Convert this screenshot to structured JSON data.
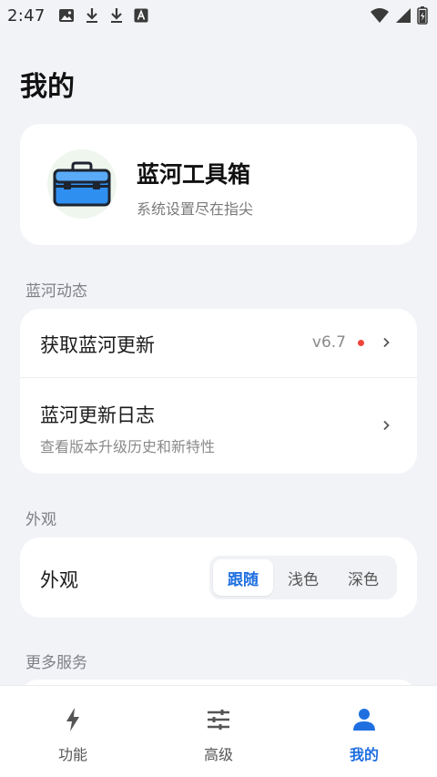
{
  "status_bar": {
    "time": "2:47",
    "left_icons": [
      "image-icon",
      "download-icon",
      "download-icon",
      "font-icon"
    ],
    "right_icons": [
      "wifi-icon",
      "signal-icon",
      "battery-icon"
    ]
  },
  "page": {
    "title": "我的"
  },
  "app": {
    "name": "蓝河工具箱",
    "subtitle": "系统设置尽在指尖",
    "logo_icon": "toolbox-icon"
  },
  "sections": {
    "dynamic_label": "蓝河动态",
    "appearance_label": "外观",
    "more_label": "更多服务"
  },
  "dynamic": {
    "get_update": {
      "title": "获取蓝河更新",
      "version": "v6.7",
      "has_badge": true
    },
    "changelog": {
      "title": "蓝河更新日志",
      "subtitle": "查看版本升级历史和新特性"
    }
  },
  "appearance": {
    "label": "外观",
    "options": [
      "跟随",
      "浅色",
      "深色"
    ],
    "selected": "跟随"
  },
  "bottom_nav": {
    "items": [
      {
        "label": "功能",
        "icon": "bolt-icon",
        "active": false
      },
      {
        "label": "高级",
        "icon": "sliders-icon",
        "active": false
      },
      {
        "label": "我的",
        "icon": "person-icon",
        "active": true
      }
    ]
  },
  "colors": {
    "background": "#f2f3f7",
    "accent": "#1f6fe0",
    "badge": "#f0443a",
    "card": "#ffffff"
  }
}
